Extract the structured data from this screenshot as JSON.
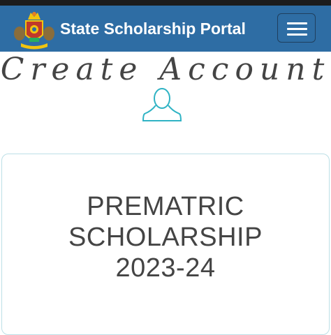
{
  "header": {
    "brand": "State Scholarship Portal",
    "background_color": "#2e6da4",
    "logo_icon": "state-emblem",
    "menu_icon": "hamburger-menu"
  },
  "page": {
    "heading": "Create Account",
    "user_icon": "user-outline",
    "accent_color": "#2fb3c4"
  },
  "card": {
    "title_lines": [
      "PREMATRIC",
      "SCHOLARSHIP",
      "2023-24"
    ]
  }
}
